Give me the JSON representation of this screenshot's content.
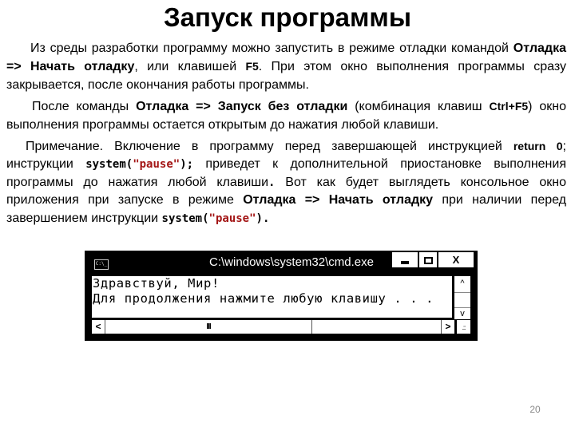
{
  "slide": {
    "title": "Запуск программы",
    "page_number": "20"
  },
  "paragraph1": {
    "t1": "Из среды разработки программу можно запустить в режиме отладки командой ",
    "b1": "Отладка => Начать отладку",
    "t2": ", или клавишей ",
    "key": "F5",
    "t3": ". При этом окно выполнения программы сразу закрывается, после окончания работы программы."
  },
  "paragraph2": {
    "t1": "После команды ",
    "b1": "Отладка => Запуск без отладки",
    "t2": " (комбинация клавиш ",
    "key": "Ctrl+F5",
    "t3": ") окно выполнения программы остается открытым до нажатия любой клавиши."
  },
  "paragraph3": {
    "t1": "Примечание. Включение в программу перед завершающей инструкцией ",
    "kw_return": "return 0",
    "t2": "; инструкции ",
    "code1_a": "system(",
    "code1_str": "\"pause\"",
    "code1_b": ");",
    "t3": " приведет к дополнительной приостановке выполнения программы до нажатия любой клавиши",
    "code_dot": ".",
    "t4": " Вот как будет выглядеть консольное окно приложения при запуске в режиме ",
    "b1": "Отладка => Начать отладку",
    "t5": " при наличии перед завершением инструкции ",
    "code2_a": "system(",
    "code2_str": "\"pause\"",
    "code2_b": ")."
  },
  "console_window": {
    "icon_label": "C:\\_",
    "title": "C:\\windows\\system32\\cmd.exe",
    "buttons": {
      "minimize": "minimize",
      "maximize": "maximize",
      "close": "X"
    },
    "lines": [
      "Здравствуй, Мир!",
      "Для продолжения нажмите любую клавишу . . ."
    ],
    "scroll": {
      "up": "^",
      "down": "v",
      "left": "<",
      "right": ">",
      "thumb_grip": "III",
      "resize_grip": ".::"
    }
  }
}
